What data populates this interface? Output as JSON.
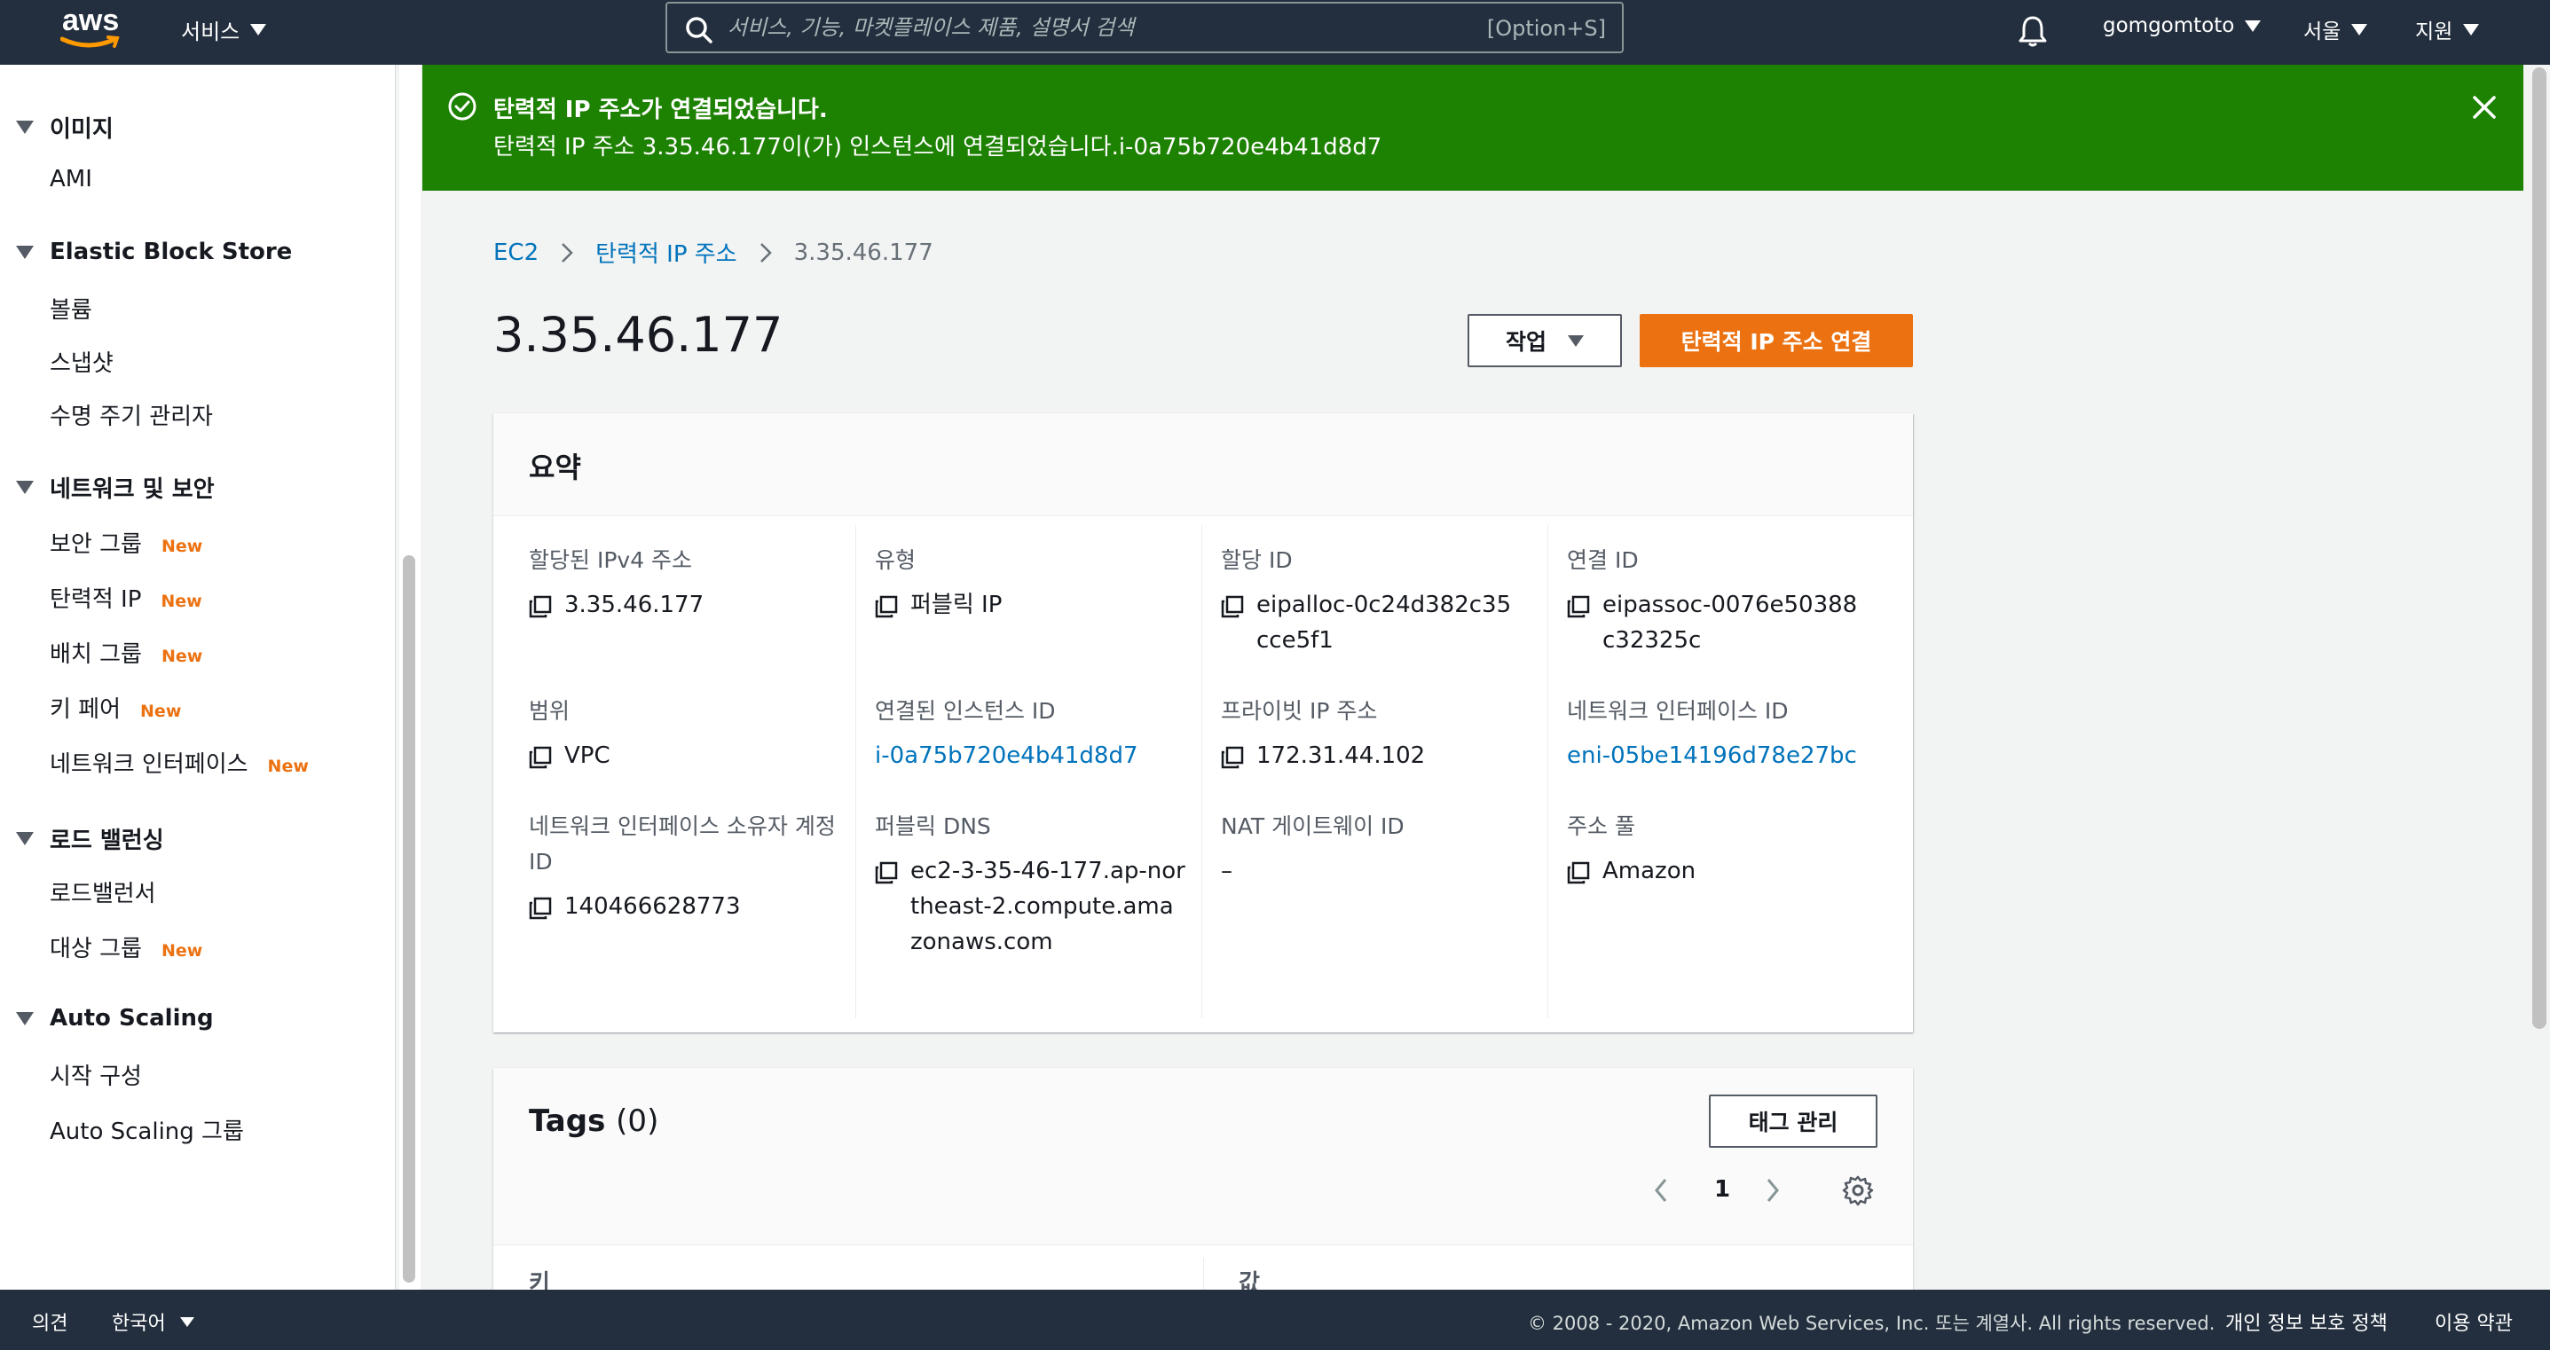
{
  "topnav": {
    "logo": "aws",
    "services": "서비스",
    "search_placeholder": "서비스, 기능, 마켓플레이스 제품, 설명서 검색",
    "search_shortcut": "[Option+S]",
    "user": "gomgomtoto",
    "region": "서울",
    "support": "지원"
  },
  "sidebar": {
    "sections": [
      {
        "title": "이미지",
        "items": [
          {
            "label": "AMI",
            "badge": ""
          }
        ]
      },
      {
        "title": "Elastic Block Store",
        "items": [
          {
            "label": "볼륨",
            "badge": ""
          },
          {
            "label": "스냅샷",
            "badge": ""
          },
          {
            "label": "수명 주기 관리자",
            "badge": ""
          }
        ]
      },
      {
        "title": "네트워크 및 보안",
        "items": [
          {
            "label": "보안 그룹",
            "badge": "New"
          },
          {
            "label": "탄력적 IP",
            "badge": "New"
          },
          {
            "label": "배치 그룹",
            "badge": "New"
          },
          {
            "label": "키 페어",
            "badge": "New"
          },
          {
            "label": "네트워크 인터페이스",
            "badge": "New"
          }
        ]
      },
      {
        "title": "로드 밸런싱",
        "items": [
          {
            "label": "로드밸런서",
            "badge": ""
          },
          {
            "label": "대상 그룹",
            "badge": "New"
          }
        ]
      },
      {
        "title": "Auto Scaling",
        "items": [
          {
            "label": "시작 구성",
            "badge": ""
          },
          {
            "label": "Auto Scaling 그룹",
            "badge": ""
          }
        ]
      }
    ]
  },
  "flash": {
    "title": "탄력적 IP 주소가 연결되었습니다.",
    "message": "탄력적 IP 주소 3.35.46.177이(가) 인스턴스에 연결되었습니다.i-0a75b720e4b41d8d7"
  },
  "breadcrumb": {
    "items": [
      "EC2",
      "탄력적 IP 주소"
    ],
    "current": "3.35.46.177"
  },
  "page": {
    "title": "3.35.46.177",
    "actions_label": "작업",
    "associate_label": "탄력적 IP 주소 연결"
  },
  "summary": {
    "title": "요약",
    "fields": {
      "ipv4": {
        "label": "할당된 IPv4 주소",
        "value": "3.35.46.177"
      },
      "type": {
        "label": "유형",
        "value": "퍼블릭 IP"
      },
      "alloc": {
        "label": "할당 ID",
        "value": "eipalloc-0c24d382c35cce5f1"
      },
      "assoc": {
        "label": "연결 ID",
        "value": "eipassoc-0076e50388c32325c"
      },
      "scope": {
        "label": "범위",
        "value": "VPC"
      },
      "instance": {
        "label": "연결된 인스턴스 ID",
        "value": "i-0a75b720e4b41d8d7"
      },
      "private_ip": {
        "label": "프라이빗 IP 주소",
        "value": "172.31.44.102"
      },
      "eni": {
        "label": "네트워크 인터페이스 ID",
        "value": "eni-05be14196d78e27bc"
      },
      "owner": {
        "label": "네트워크 인터페이스 소유자 계정 ID",
        "value": "140466628773"
      },
      "dns": {
        "label": "퍼블릭 DNS",
        "value": "ec2-3-35-46-177.ap-northeast-2.compute.amazonaws.com"
      },
      "nat": {
        "label": "NAT 게이트웨이 ID",
        "value": "–"
      },
      "pool": {
        "label": "주소 풀",
        "value": "Amazon"
      }
    }
  },
  "tags": {
    "title": "Tags",
    "count": "(0)",
    "manage_label": "태그 관리",
    "page": "1",
    "col_key": "키",
    "col_value": "값"
  },
  "footer": {
    "feedback": "의견",
    "language": "한국어",
    "copyright": "© 2008 - 2020, Amazon Web Services, Inc. 또는 계열사. All rights reserved.",
    "privacy": "개인 정보 보호 정책",
    "terms": "이용 약관"
  },
  "colors": {
    "nav_bg": "#232f3e",
    "success": "#1d8102",
    "primary": "#ec7211",
    "link": "#0073bb"
  }
}
